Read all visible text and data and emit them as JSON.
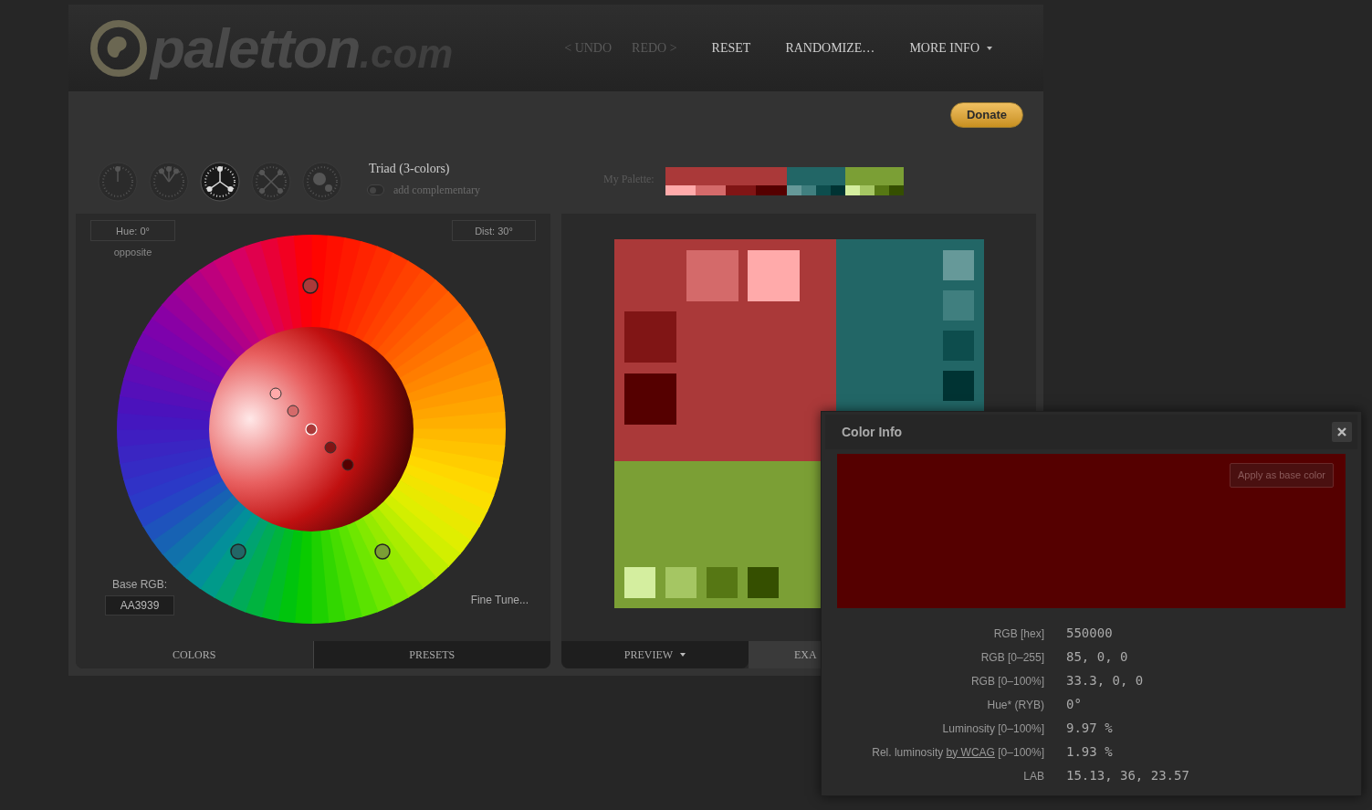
{
  "header": {
    "logo": {
      "name": "paletton",
      "suffix": ".com"
    },
    "nav": [
      {
        "label": "< UNDO",
        "disabled": true,
        "caret": false
      },
      {
        "label": "REDO >",
        "disabled": true,
        "caret": false
      },
      {
        "label": "RESET",
        "disabled": false,
        "caret": false
      },
      {
        "label": "RANDOMIZE…",
        "disabled": false,
        "caret": false
      },
      {
        "label": "MORE INFO",
        "disabled": false,
        "caret": true
      }
    ]
  },
  "donate": {
    "label": "Donate"
  },
  "schemes": [
    {
      "kind": "mono",
      "selected": false
    },
    {
      "kind": "adjacent",
      "selected": false
    },
    {
      "kind": "triad",
      "selected": true
    },
    {
      "kind": "tetrad",
      "selected": false
    },
    {
      "kind": "free",
      "selected": false
    }
  ],
  "scheme_name": "Triad (3-colors)",
  "complementary": {
    "label": "add complementary",
    "on": false
  },
  "my_palette": {
    "label": "My Palette:",
    "groups": [
      {
        "color": "#aa3939",
        "shades": [
          {
            "color": "#ffaaaa"
          },
          {
            "color": "#d46a6a"
          },
          {
            "color": "#801515"
          },
          {
            "color": "#550000"
          }
        ]
      },
      {
        "color": "#226666",
        "shades": [
          {
            "color": "#669999"
          },
          {
            "color": "#407f7f"
          },
          {
            "color": "#0d4d4d"
          },
          {
            "color": "#003333"
          }
        ]
      },
      {
        "color": "#7b9f35",
        "shades": [
          {
            "color": "#d4ee9f"
          },
          {
            "color": "#a5c663"
          },
          {
            "color": "#567714"
          },
          {
            "color": "#354f00"
          }
        ]
      }
    ]
  },
  "wheel_panel": {
    "hue": "Hue: 0°",
    "hue_note": "opposite",
    "dist": "Dist: 30°",
    "base_label": "Base RGB:",
    "base_value": "AA3939",
    "fine_tune": "Fine Tune...",
    "tabs": [
      {
        "label": "COLORS",
        "selected": true
      },
      {
        "label": "PRESETS",
        "selected": false
      }
    ]
  },
  "preview_panel": {
    "tabs": [
      {
        "label": "PREVIEW",
        "selected": true,
        "caret": true
      },
      {
        "label": "EXA",
        "selected": false
      }
    ]
  },
  "color_info": {
    "title": "Color Info",
    "color": "#550000",
    "apply": "Apply as base color",
    "rows": [
      {
        "label": "RGB [hex]",
        "value": "550000"
      },
      {
        "label": "RGB [0–255]",
        "value": "85, 0, 0"
      },
      {
        "label": "RGB [0–100%]",
        "value": "33.3, 0, 0"
      },
      {
        "label": "Hue* (RYB)",
        "value": "0°"
      },
      {
        "label": "Luminosity [0–100%]",
        "value": "9.97 %"
      },
      {
        "label": "Rel. luminosity",
        "link": "by WCAG",
        "label_after": "[0–100%]",
        "value": "1.93 %"
      },
      {
        "label": "LAB",
        "value": "15.13, 36, 23.57"
      }
    ]
  }
}
